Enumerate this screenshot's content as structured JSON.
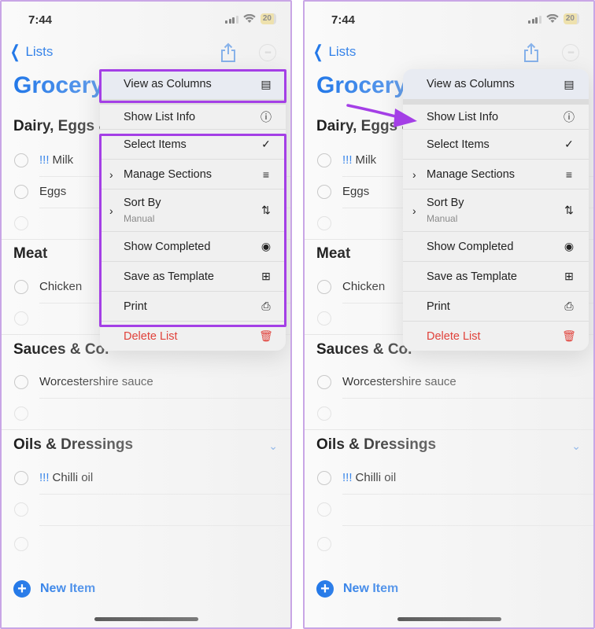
{
  "status": {
    "time": "7:44",
    "battery": "20"
  },
  "nav": {
    "back_label": "Lists"
  },
  "list_title": "Grocery",
  "sections": [
    {
      "title": "Dairy, Eggs &",
      "items": [
        {
          "priority": "!!!",
          "text": "Milk"
        },
        {
          "priority": "",
          "text": "Eggs"
        },
        {
          "priority": "",
          "text": ""
        }
      ]
    },
    {
      "title": "Meat",
      "items": [
        {
          "priority": "",
          "text": "Chicken"
        },
        {
          "priority": "",
          "text": ""
        }
      ]
    },
    {
      "title": "Sauces & Co.",
      "items": [
        {
          "priority": "",
          "text": "Worcestershire sauce"
        },
        {
          "priority": "",
          "text": ""
        }
      ]
    },
    {
      "title": "Oils & Dressings",
      "items": [
        {
          "priority": "!!!",
          "text": "Chilli oil"
        },
        {
          "priority": "",
          "text": ""
        },
        {
          "priority": "",
          "text": ""
        }
      ]
    }
  ],
  "new_item_label": "New Item",
  "menu": {
    "items": [
      {
        "label": "View as Columns",
        "icon": "columns-icon",
        "glyph": "▤"
      },
      {
        "label": "Show List Info",
        "icon": "info-icon",
        "glyph": "ⓘ"
      },
      {
        "label": "Select Items",
        "icon": "checkmark-circle-icon",
        "glyph": "✓"
      },
      {
        "label": "Manage Sections",
        "icon": "sections-icon",
        "glyph": "≡",
        "submenu": true
      },
      {
        "label": "Sort By",
        "sublabel": "Manual",
        "icon": "sort-icon",
        "glyph": "⇅",
        "submenu": true
      },
      {
        "label": "Show Completed",
        "icon": "eye-icon",
        "glyph": "◉"
      },
      {
        "label": "Save as Template",
        "icon": "template-icon",
        "glyph": "⊞"
      },
      {
        "label": "Print",
        "icon": "printer-icon",
        "glyph": "⎙"
      },
      {
        "label": "Delete List",
        "icon": "trash-icon",
        "glyph": "🗑",
        "danger": true
      }
    ]
  },
  "colors": {
    "accent": "#1a73e8",
    "highlight": "#a43fe6",
    "danger": "#e0413a"
  }
}
